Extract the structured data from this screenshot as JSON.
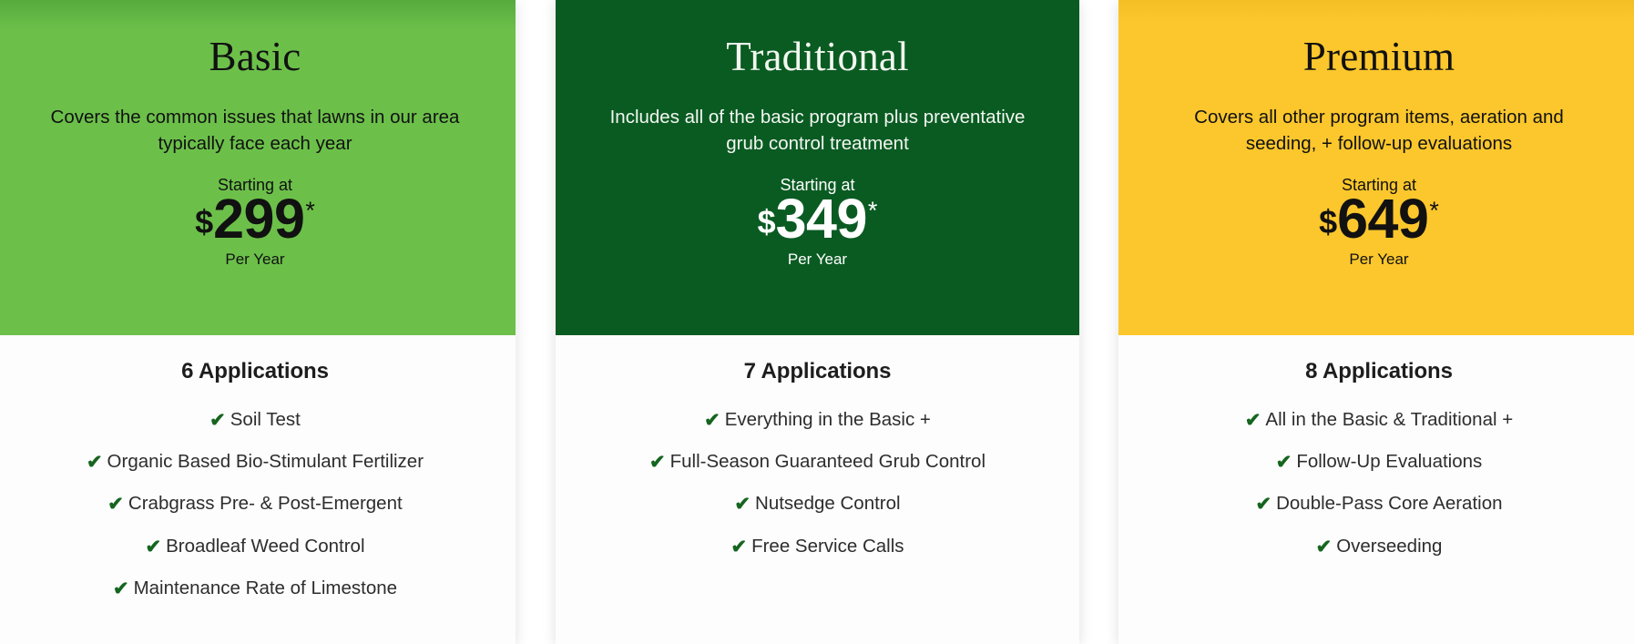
{
  "colors": {
    "basic_header_bg": "#6CC04A",
    "traditional_header_bg": "#0A5B22",
    "premium_header_bg": "#FCC72C",
    "check_green": "#15651F",
    "card_body_bg": "#FDFDFD"
  },
  "labels": {
    "starting_at": "Starting at",
    "per_year": "Per Year",
    "currency_symbol": "$",
    "asterisk": "*",
    "check_icon": "check-icon"
  },
  "plans": [
    {
      "id": "basic",
      "name": "Basic",
      "description": "Covers the common issues that lawns in our area typically face each year",
      "starting_at": "Starting at",
      "currency": "$",
      "price": "299",
      "asterisk": "*",
      "per_year": "Per Year",
      "applications": "6 Applications",
      "features": [
        "Soil Test",
        "Organic Based Bio-Stimulant Fertilizer",
        "Crabgrass Pre- & Post-Emergent",
        "Broadleaf Weed Control",
        "Maintenance Rate of Limestone"
      ]
    },
    {
      "id": "traditional",
      "name": "Traditional",
      "description": "Includes all of the basic program plus preventative grub control treatment",
      "starting_at": "Starting at",
      "currency": "$",
      "price": "349",
      "asterisk": "*",
      "per_year": "Per Year",
      "applications": "7 Applications",
      "features": [
        "Everything in the Basic +",
        "Full-Season Guaranteed Grub Control",
        "Nutsedge Control",
        "Free Service Calls"
      ]
    },
    {
      "id": "premium",
      "name": "Premium",
      "description": "Covers all other program items, aeration and seeding, + follow-up evaluations",
      "starting_at": "Starting at",
      "currency": "$",
      "price": "649",
      "asterisk": "*",
      "per_year": "Per Year",
      "applications": "8 Applications",
      "features": [
        "All in the Basic & Traditional +",
        "Follow-Up Evaluations",
        "Double-Pass Core Aeration",
        "Overseeding"
      ]
    }
  ]
}
